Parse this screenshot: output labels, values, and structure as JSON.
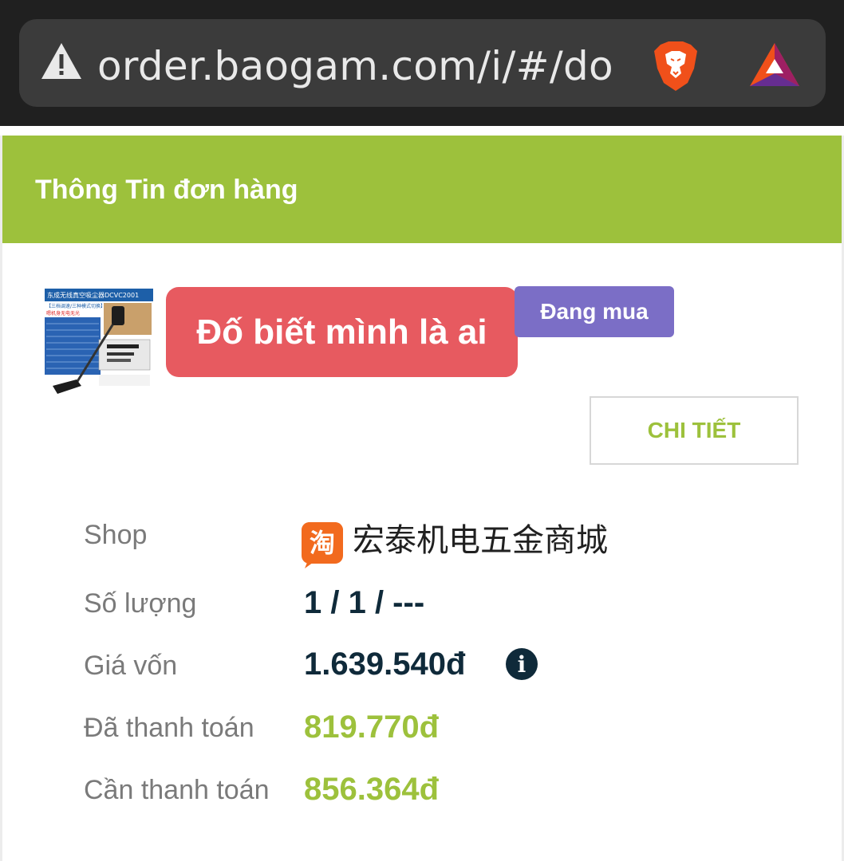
{
  "browser": {
    "url": "order.baogam.com/i/#/do",
    "icons": [
      "warning-icon",
      "brave-lion-icon",
      "bat-rewards-icon"
    ],
    "colors": {
      "bar": "#202020",
      "pill": "#3b3b3b",
      "brave": "#f0501a"
    }
  },
  "order": {
    "section_title": "Thông Tin đơn hàng",
    "label_overlay": "Đố biết mình là ai",
    "status_badge": "Đang mua",
    "detail_button": "CHI TIẾT",
    "thumbnail": {
      "title_text": "东成无线真空吸尘器DCVC2001",
      "subtitle_text": "【三档调速/三种模式切换】",
      "tag_text": "嗯机身无电无光"
    },
    "rows": [
      {
        "label": "Shop",
        "value": "宏泰机电五金商城",
        "icon": "taobao-icon"
      },
      {
        "label": "Số lượng",
        "value": "1 / 1 / ---"
      },
      {
        "label": "Giá vốn",
        "value": "1.639.540đ",
        "icon": "info-icon"
      },
      {
        "label": "Đã thanh toán",
        "value": "819.770đ"
      },
      {
        "label": "Cần thanh toán",
        "value": "856.364đ"
      }
    ],
    "taobao_glyph": "淘",
    "info_glyph": "i"
  },
  "colors": {
    "accent_green": "#9dc13c",
    "overlay_red": "#e75a60",
    "badge_purple": "#7b6ec6",
    "value_dark": "#0f2a3a"
  }
}
